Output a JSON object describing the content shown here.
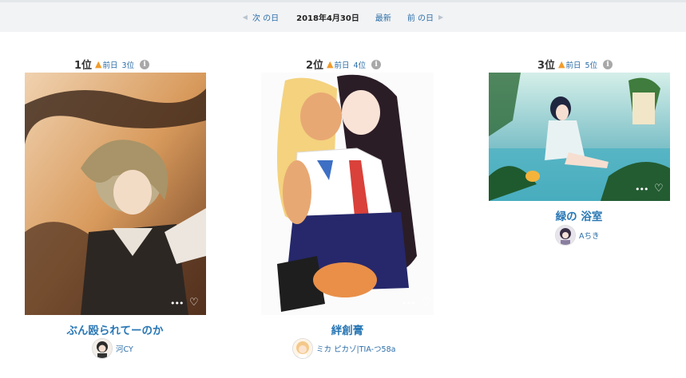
{
  "date_nav": {
    "prev_label": "次 の日",
    "current_date": "2018年4月30日",
    "latest_label": "最新",
    "next_label": "前 の日"
  },
  "rankings": [
    {
      "rank_label": "1位",
      "prev_label": "前日",
      "prev_rank": "3位",
      "title": "ぶん殴られてーのか",
      "author": "河CY"
    },
    {
      "rank_label": "2位",
      "prev_label": "前日",
      "prev_rank": "4位",
      "title": "絆創膏",
      "author": "ミカ ピカゾ|TIA-つ58a"
    },
    {
      "rank_label": "3位",
      "prev_label": "前日",
      "prev_rank": "5位",
      "title": "緑の 浴室",
      "author": "Aちき"
    }
  ],
  "icons": {
    "up_arrow": "arrow-up-icon",
    "info": "info-icon",
    "more": "more-dots-icon",
    "like": "heart-icon"
  },
  "colors": {
    "link": "#2c6ea8",
    "title": "#2a78b5",
    "up_arrow": "#f29b2b",
    "bar_bg": "#f2f3f5"
  }
}
